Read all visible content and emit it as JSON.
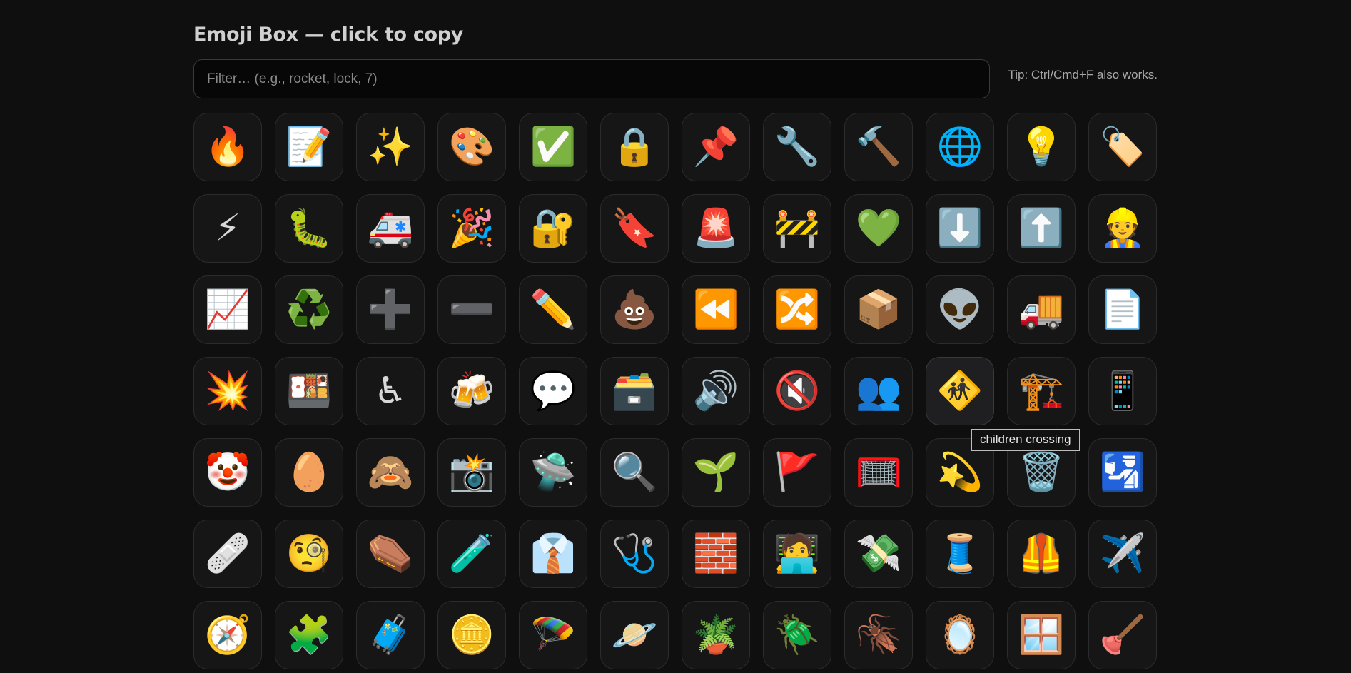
{
  "header": {
    "title": "Emoji Box — click to copy"
  },
  "filter": {
    "placeholder": "Filter… (e.g., rocket, lock, 7)",
    "value": ""
  },
  "tip": "Tip: Ctrl/Cmd+F also works.",
  "tooltip": {
    "text": "children crossing"
  },
  "emojis": [
    {
      "char": "🔥",
      "name": "fire"
    },
    {
      "char": "📝",
      "name": "memo"
    },
    {
      "char": "✨",
      "name": "sparkles"
    },
    {
      "char": "🎨",
      "name": "artist palette"
    },
    {
      "char": "✅",
      "name": "check mark button"
    },
    {
      "char": "🔒",
      "name": "locked"
    },
    {
      "char": "📌",
      "name": "pushpin"
    },
    {
      "char": "🔧",
      "name": "wrench"
    },
    {
      "char": "🔨",
      "name": "hammer"
    },
    {
      "char": "🌐",
      "name": "globe with meridians"
    },
    {
      "char": "💡",
      "name": "light bulb"
    },
    {
      "char": "🏷️",
      "name": "label"
    },
    {
      "char": "⚡",
      "name": "high voltage"
    },
    {
      "char": "🐛",
      "name": "bug"
    },
    {
      "char": "🚑",
      "name": "ambulance"
    },
    {
      "char": "🎉",
      "name": "party popper"
    },
    {
      "char": "🔐",
      "name": "locked with key"
    },
    {
      "char": "🔖",
      "name": "bookmark"
    },
    {
      "char": "🚨",
      "name": "police car light"
    },
    {
      "char": "🚧",
      "name": "construction"
    },
    {
      "char": "💚",
      "name": "green heart"
    },
    {
      "char": "⬇️",
      "name": "down arrow"
    },
    {
      "char": "⬆️",
      "name": "up arrow"
    },
    {
      "char": "👷",
      "name": "construction worker"
    },
    {
      "char": "📈",
      "name": "chart increasing"
    },
    {
      "char": "♻️",
      "name": "recycling symbol"
    },
    {
      "char": "➕",
      "name": "plus"
    },
    {
      "char": "➖",
      "name": "minus"
    },
    {
      "char": "✏️",
      "name": "pencil"
    },
    {
      "char": "💩",
      "name": "pile of poo"
    },
    {
      "char": "⏪",
      "name": "fast reverse button"
    },
    {
      "char": "🔀",
      "name": "shuffle tracks button"
    },
    {
      "char": "📦",
      "name": "package"
    },
    {
      "char": "👽",
      "name": "alien"
    },
    {
      "char": "🚚",
      "name": "delivery truck"
    },
    {
      "char": "📄",
      "name": "page facing up"
    },
    {
      "char": "💥",
      "name": "collision"
    },
    {
      "char": "🍱",
      "name": "bento box"
    },
    {
      "char": "♿",
      "name": "wheelchair symbol"
    },
    {
      "char": "🍻",
      "name": "clinking beer mugs"
    },
    {
      "char": "💬",
      "name": "speech balloon"
    },
    {
      "char": "🗃️",
      "name": "card file box"
    },
    {
      "char": "🔊",
      "name": "speaker high volume"
    },
    {
      "char": "🔇",
      "name": "muted speaker"
    },
    {
      "char": "👥",
      "name": "busts in silhouette"
    },
    {
      "char": "🚸",
      "name": "children crossing"
    },
    {
      "char": "🏗️",
      "name": "building construction"
    },
    {
      "char": "📱",
      "name": "mobile phone"
    },
    {
      "char": "🤡",
      "name": "clown face"
    },
    {
      "char": "🥚",
      "name": "egg"
    },
    {
      "char": "🙈",
      "name": "see-no-evil monkey"
    },
    {
      "char": "📸",
      "name": "camera with flash"
    },
    {
      "char": "🛸",
      "name": "flying saucer"
    },
    {
      "char": "🔍",
      "name": "magnifying glass tilted left"
    },
    {
      "char": "🌱",
      "name": "seedling"
    },
    {
      "char": "🚩",
      "name": "triangular flag"
    },
    {
      "char": "🥅",
      "name": "goal net"
    },
    {
      "char": "💫",
      "name": "dizzy"
    },
    {
      "char": "🗑️",
      "name": "wastebasket"
    },
    {
      "char": "🛂",
      "name": "passport control"
    },
    {
      "char": "🩹",
      "name": "adhesive bandage"
    },
    {
      "char": "🧐",
      "name": "face with monocle"
    },
    {
      "char": "⚰️",
      "name": "coffin"
    },
    {
      "char": "🧪",
      "name": "test tube"
    },
    {
      "char": "👔",
      "name": "necktie"
    },
    {
      "char": "🩺",
      "name": "stethoscope"
    },
    {
      "char": "🧱",
      "name": "brick"
    },
    {
      "char": "🧑‍💻",
      "name": "technologist"
    },
    {
      "char": "💸",
      "name": "money with wings"
    },
    {
      "char": "🧵",
      "name": "thread"
    },
    {
      "char": "🦺",
      "name": "safety vest"
    },
    {
      "char": "✈️",
      "name": "airplane"
    },
    {
      "char": "🧭",
      "name": "compass"
    },
    {
      "char": "🧩",
      "name": "puzzle piece"
    },
    {
      "char": "🧳",
      "name": "luggage"
    },
    {
      "char": "🪙",
      "name": "coin"
    },
    {
      "char": "🪂",
      "name": "parachute"
    },
    {
      "char": "🪐",
      "name": "ringed planet"
    },
    {
      "char": "🪴",
      "name": "potted plant"
    },
    {
      "char": "🪲",
      "name": "beetle"
    },
    {
      "char": "🪳",
      "name": "cockroach"
    },
    {
      "char": "🪞",
      "name": "mirror"
    },
    {
      "char": "🪟",
      "name": "window"
    },
    {
      "char": "🪠",
      "name": "plunger"
    }
  ],
  "hovered_index": 45
}
